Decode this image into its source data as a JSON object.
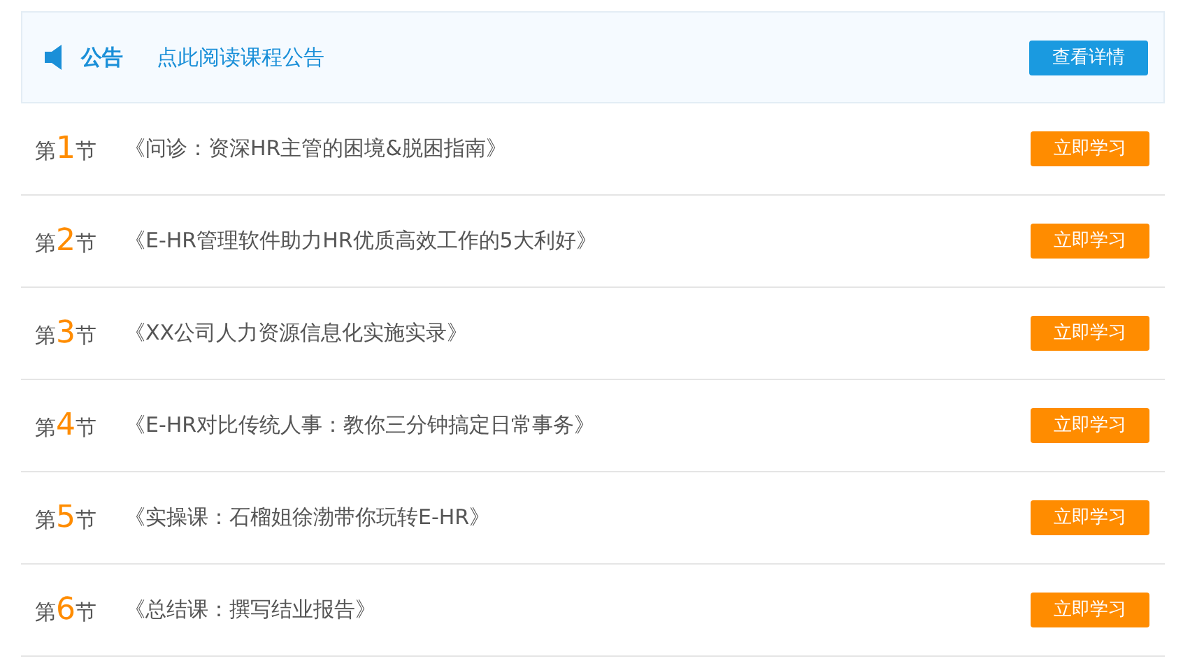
{
  "notice": {
    "label": "公告",
    "link": "点此阅读课程公告",
    "button": "查看详情"
  },
  "lessons": [
    {
      "prefix": "第",
      "number": "1",
      "suffix": "节",
      "title": "《问诊：资深HR主管的困境&脱困指南》",
      "button": "立即学习"
    },
    {
      "prefix": "第",
      "number": "2",
      "suffix": "节",
      "title": "《E-HR管理软件助力HR优质高效工作的5大利好》",
      "button": "立即学习"
    },
    {
      "prefix": "第",
      "number": "3",
      "suffix": "节",
      "title": "《XX公司人力资源信息化实施实录》",
      "button": "立即学习"
    },
    {
      "prefix": "第",
      "number": "4",
      "suffix": "节",
      "title": "《E-HR对比传统人事：教你三分钟搞定日常事务》",
      "button": "立即学习"
    },
    {
      "prefix": "第",
      "number": "5",
      "suffix": "节",
      "title": "《实操课：石榴姐徐渤带你玩转E-HR》",
      "button": "立即学习"
    },
    {
      "prefix": "第",
      "number": "6",
      "suffix": "节",
      "title": "《总结课：撰写结业报告》",
      "button": "立即学习"
    }
  ]
}
